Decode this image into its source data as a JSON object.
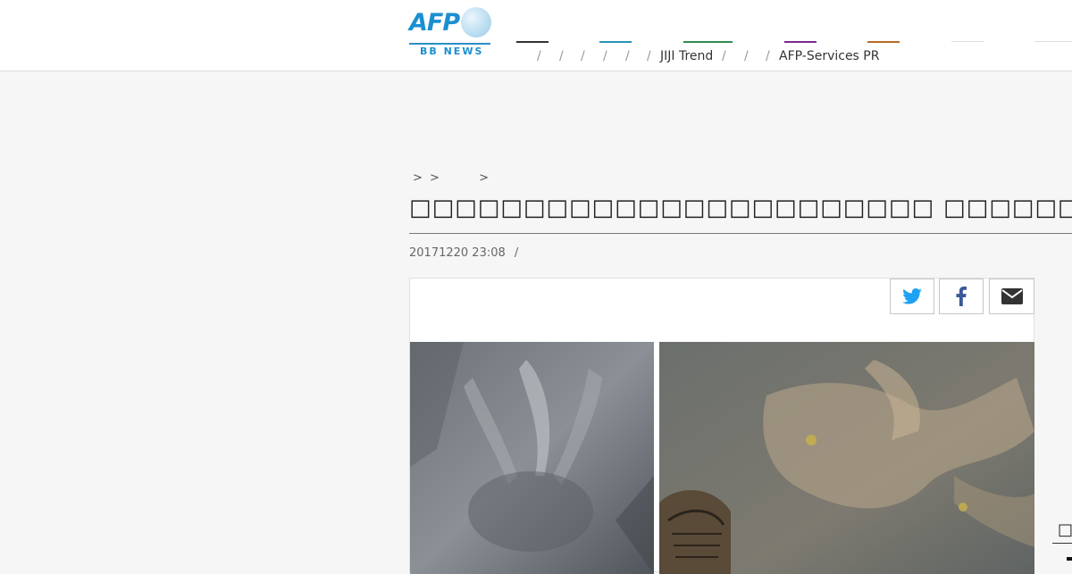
{
  "header": {
    "logo": {
      "brand": "AFP",
      "sub": "BB NEWS"
    },
    "nav_colors": [
      "#333333",
      "#2a93b5",
      "#2e8b4e",
      "#7a2a8c",
      "#b86a25",
      "#dddddd",
      "#dddddd"
    ],
    "nav_separator": "/",
    "nav_items": [
      "JIJI Trend",
      "AFP-Services PR"
    ]
  },
  "breadcrumb": {
    "separator": ">"
  },
  "article": {
    "title": "□□□□□□□□□□□□□□□□□□□□□□□ □□□□□□□□",
    "date": "20171220 23:08",
    "meta_sep": "/"
  },
  "share": {
    "twitter_color": "#1da1f2",
    "facebook_color": "#3b5998",
    "mail_color": "#333333"
  },
  "side": {
    "chip": "□"
  }
}
